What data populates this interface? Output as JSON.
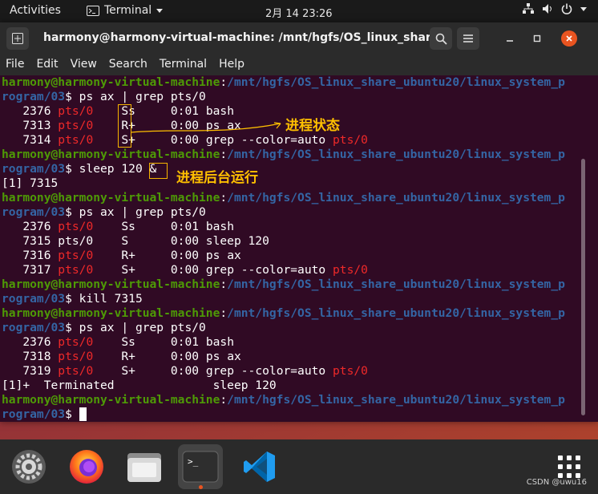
{
  "topbar": {
    "activities": "Activities",
    "app_name": "Terminal",
    "clock": "2月 14  23:26"
  },
  "window": {
    "title": "harmony@harmony-virtual-machine: /mnt/hgfs/OS_linux_share...",
    "menu": [
      "File",
      "Edit",
      "View",
      "Search",
      "Terminal",
      "Help"
    ]
  },
  "terminal": {
    "user": "harmony@harmony-virtual-machine",
    "path_line1": "/mnt/hgfs/OS_linux_share_ubuntu20/linux_system_p",
    "path_line2": "rogram/03",
    "lines": [
      {
        "kind": "prompt",
        "cmd": "ps ax | grep pts/0"
      },
      {
        "kind": "proc",
        "pid": "   2376 ",
        "tty": "pts/0",
        "gap": "    ",
        "stat": "Ss  ",
        "rest": "   0:01 bash"
      },
      {
        "kind": "proc",
        "pid": "   7313 ",
        "tty": "pts/0",
        "gap": "    ",
        "stat": "R+  ",
        "rest": "   0:00 ps ax"
      },
      {
        "kind": "procgrep",
        "pid": "   7314 ",
        "tty": "pts/0",
        "gap": "    ",
        "stat": "S+  ",
        "rest": "   0:00 grep --color=auto ",
        "tty2": "pts/0"
      },
      {
        "kind": "prompt",
        "cmd": "sleep 120 &"
      },
      {
        "kind": "plain",
        "text": "[1] 7315"
      },
      {
        "kind": "prompt",
        "cmd": "ps ax | grep pts/0"
      },
      {
        "kind": "proc",
        "pid": "   2376 ",
        "tty": "pts/0",
        "gap": "    ",
        "stat": "Ss  ",
        "rest": "   0:01 bash"
      },
      {
        "kind": "procplain",
        "text": "   7315 pts/0    S      0:00 sleep 120"
      },
      {
        "kind": "proc",
        "pid": "   7316 ",
        "tty": "pts/0",
        "gap": "    ",
        "stat": "R+  ",
        "rest": "   0:00 ps ax"
      },
      {
        "kind": "procgrep",
        "pid": "   7317 ",
        "tty": "pts/0",
        "gap": "    ",
        "stat": "S+  ",
        "rest": "   0:00 grep --color=auto ",
        "tty2": "pts/0"
      },
      {
        "kind": "prompt",
        "cmd": "kill 7315"
      },
      {
        "kind": "prompt",
        "cmd": "ps ax | grep pts/0"
      },
      {
        "kind": "proc",
        "pid": "   2376 ",
        "tty": "pts/0",
        "gap": "    ",
        "stat": "Ss  ",
        "rest": "   0:01 bash"
      },
      {
        "kind": "proc",
        "pid": "   7318 ",
        "tty": "pts/0",
        "gap": "    ",
        "stat": "R+  ",
        "rest": "   0:00 ps ax"
      },
      {
        "kind": "procgrep",
        "pid": "   7319 ",
        "tty": "pts/0",
        "gap": "    ",
        "stat": "S+  ",
        "rest": "   0:00 grep --color=auto ",
        "tty2": "pts/0"
      },
      {
        "kind": "plain",
        "text": "[1]+  Terminated              sleep 120"
      },
      {
        "kind": "prompt_cursor",
        "cmd": ""
      }
    ]
  },
  "annotations": {
    "process_state": "进程状态",
    "background_run": "进程后台运行",
    "color": "#ffc000"
  },
  "dock": {
    "items": [
      "settings-icon",
      "firefox-icon",
      "files-icon",
      "terminal-icon",
      "vscode-icon"
    ],
    "apps_grid": "show-applications-icon"
  },
  "watermark": "CSDN @uwu16"
}
